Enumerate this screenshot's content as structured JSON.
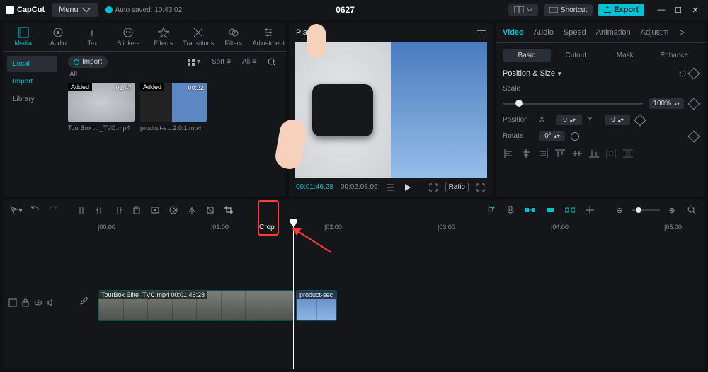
{
  "titlebar": {
    "logo": "CapCut",
    "menu": "Menu",
    "autosave": "Auto saved: 10:43:02",
    "project": "0627",
    "shortcut": "Shortcut",
    "export": "Export"
  },
  "media": {
    "tabs": [
      "Media",
      "Audio",
      "Text",
      "Stickers",
      "Effects",
      "Transitions",
      "Filters",
      "Adjustment"
    ],
    "side": [
      "Local",
      "Import",
      "Library"
    ],
    "import": "Import",
    "sort": "Sort",
    "all": "All",
    "all_header": "All",
    "clips": [
      {
        "badge": "Added",
        "dur": "01:47",
        "name": "TourBox …_TVC.mp4"
      },
      {
        "badge": "Added",
        "dur": "00:22",
        "name": "product-s…2.0.1.mp4"
      }
    ]
  },
  "player": {
    "title": "Player",
    "tc1": "00:01:46:28",
    "tc2": "00:02:08:06",
    "ratio": "Ratio"
  },
  "inspector": {
    "tabs": [
      "Video",
      "Audio",
      "Speed",
      "Animation",
      "Adjustm"
    ],
    "subtabs": [
      "Basic",
      "Cutout",
      "Mask",
      "Enhance"
    ],
    "section": "Position & Size",
    "scale_label": "Scale",
    "scale_value": "100%",
    "position_label": "Position",
    "x": "X",
    "y": "Y",
    "xval": "0",
    "yval": "0",
    "rotate_label": "Rotate",
    "rotate_val": "0°"
  },
  "timeline": {
    "crop_label": "Crop",
    "marks": [
      "00:00",
      "01:00",
      "02:00",
      "03:00",
      "04:00",
      "05:00"
    ],
    "clip1": "TourBox Elite_TVC.mp4  00:01:46:28",
    "clip2": "product-sec"
  }
}
